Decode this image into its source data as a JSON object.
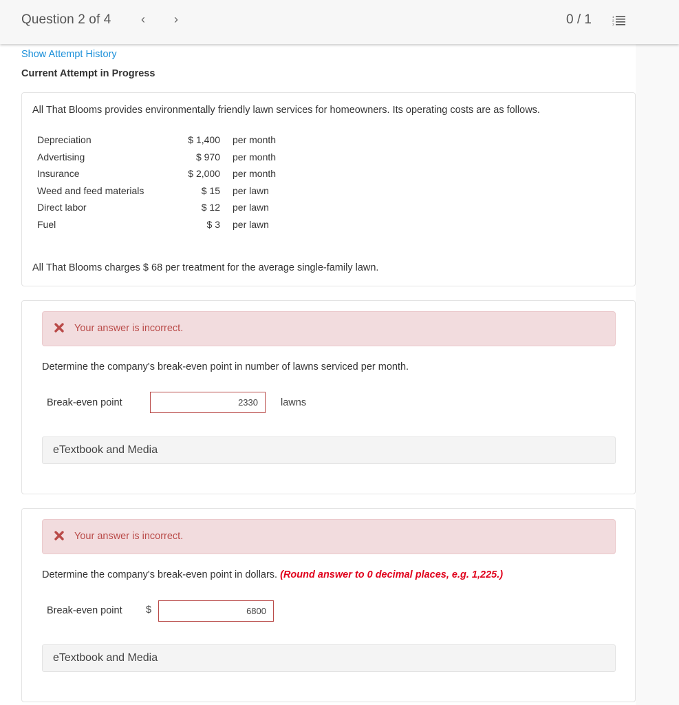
{
  "header": {
    "question_position": "Question 2 of 4",
    "prev_icon": "chevron-left-icon",
    "next_icon": "chevron-right-icon",
    "prev_glyph": "‹",
    "next_glyph": "›",
    "score": "0 / 1",
    "question_list_icon": "numbered-list-icon"
  },
  "attempt": {
    "history_link": "Show Attempt History",
    "status": "Current Attempt in Progress"
  },
  "problem": {
    "intro": "All That Blooms provides environmentally friendly lawn services for homeowners. Its operating costs are as follows.",
    "costs": [
      {
        "label": "Depreciation",
        "amount": "$ 1,400",
        "unit": "per month"
      },
      {
        "label": "Advertising",
        "amount": "$ 970",
        "unit": "per month"
      },
      {
        "label": "Insurance",
        "amount": "$ 2,000",
        "unit": "per month"
      },
      {
        "label": "Weed and feed materials",
        "amount": "$ 15",
        "unit": "per lawn"
      },
      {
        "label": "Direct labor",
        "amount": "$ 12",
        "unit": "per lawn"
      },
      {
        "label": "Fuel",
        "amount": "$ 3",
        "unit": "per lawn"
      }
    ],
    "charges": "All That Blooms charges $ 68  per treatment for the average single-family lawn."
  },
  "parts": [
    {
      "feedback": "Your answer is incorrect.",
      "feedback_color": "#b94a48",
      "question": "Determine the company's break-even point in number of lawns serviced per month.",
      "hint": "",
      "field_label": "Break-even point",
      "prefix": "",
      "value": "2330",
      "unit": "lawns",
      "etextbook": "eTextbook and Media"
    },
    {
      "feedback": "Your answer is incorrect.",
      "feedback_color": "#b94a48",
      "question": "Determine the company's break-even point in dollars. ",
      "hint": "(Round answer to 0 decimal places, e.g. 1,225.)",
      "hint_color": "#e0001b",
      "field_label": "Break-even point",
      "prefix": "$",
      "value": "6800",
      "unit": "",
      "etextbook": "eTextbook and Media"
    }
  ]
}
